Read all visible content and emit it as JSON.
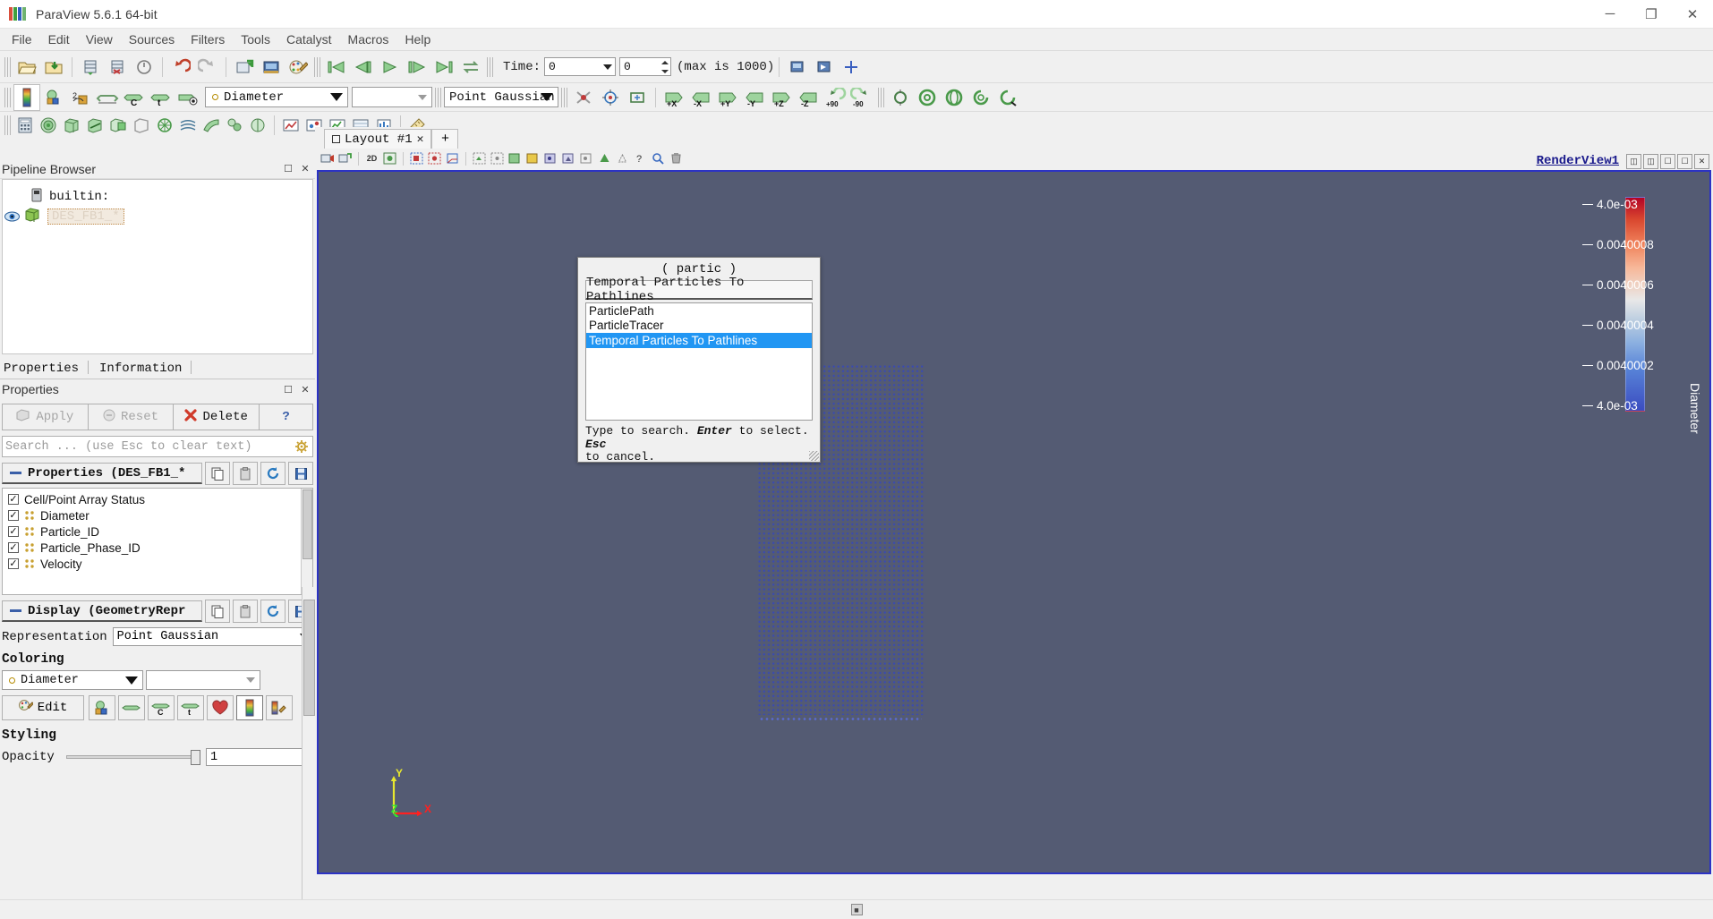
{
  "window": {
    "title": "ParaView 5.6.1 64-bit",
    "controls": {
      "minimize": "─",
      "maximize": "❐",
      "close": "✕"
    }
  },
  "menubar": {
    "items": [
      "File",
      "Edit",
      "View",
      "Sources",
      "Filters",
      "Tools",
      "Catalyst",
      "Macros",
      "Help"
    ]
  },
  "toolbars": {
    "main_icons": [
      "open-file-icon",
      "save-state-icon",
      "connect-server-icon",
      "disconnect-server-icon",
      "timer-icon",
      "undo-icon",
      "redo-icon",
      "camera-undo-icon",
      "save-screenshot-icon",
      "edit-color-map-icon"
    ],
    "vcr_icons": [
      "first-frame-icon",
      "previous-frame-icon",
      "play-icon",
      "next-frame-icon",
      "last-frame-icon",
      "loop-icon"
    ],
    "time": {
      "label": "Time:",
      "value": "0",
      "frame_index": "0",
      "max_text": "(max is 1000)"
    },
    "after_time_icons": [
      "save-data-icon",
      "save-animation-icon",
      "move-center-icon"
    ],
    "row2": {
      "icons_left": [
        "color-legend-icon",
        "rescale-data-range-icon",
        "rescale-custom-icon",
        "rescale-visible-icon",
        "rescale-time-icon",
        "rescale-temporal-icon",
        "rescale-visible-eye-icon"
      ],
      "array_selector": {
        "value": "Diameter",
        "icon": "point-data-icon"
      },
      "component_selector": {
        "value": ""
      },
      "representation": {
        "value": "Point Gaussian"
      },
      "icons_right": [
        "show-center-icon",
        "pick-center-icon",
        "reset-camera-icon",
        "plus-x-icon",
        "minus-x-icon",
        "plus-y-icon",
        "minus-y-icon",
        "plus-z-icon",
        "minus-z-icon",
        "rotate-90-ccw-icon",
        "rotate-90-cw-icon"
      ],
      "axis_labels": [
        "+X",
        "-X",
        "+Y",
        "-Y",
        "+Z",
        "-Z",
        "+90",
        "-90"
      ],
      "icons_far_right": [
        "select-center-icon",
        "sphere-icon",
        "sphere-2-icon",
        "sphere-3-icon",
        "sphere-4-icon"
      ]
    },
    "row3": {
      "icons": [
        "calculator-icon",
        "contour-icon",
        "clip-icon",
        "slice-icon",
        "threshold-icon",
        "extract-subset-icon",
        "glyph-icon",
        "stream-tracer-icon",
        "warp-icon",
        "group-datasets-icon",
        "extract-level-icon",
        "plot-data-icon",
        "plot-over-line-icon",
        "plot-selection-icon",
        "plot-time-icon",
        "plot-attributes-icon",
        "ruler-icon"
      ]
    }
  },
  "pipeline_browser": {
    "title": "Pipeline Browser",
    "dock_icons": [
      "undock-icon",
      "close-icon"
    ],
    "items": [
      {
        "label": "builtin:",
        "icon": "server-icon",
        "eye": false
      },
      {
        "label": "DES_FB1_*",
        "icon": "geometry-icon",
        "eye": true,
        "selected": true
      }
    ]
  },
  "properties_panel": {
    "tabs": [
      "Properties",
      "Information"
    ],
    "title": "Properties",
    "dock_icons": [
      "undock-icon",
      "close-icon"
    ],
    "buttons": [
      {
        "label": "Apply",
        "icon": "apply-icon",
        "enabled": false
      },
      {
        "label": "Reset",
        "icon": "reset-icon",
        "enabled": false
      },
      {
        "label": "Delete",
        "icon": "delete-icon",
        "enabled": true
      },
      {
        "label": "?",
        "icon": "help-icon",
        "enabled": true
      }
    ],
    "search_placeholder": "Search ... (use Esc to clear text)",
    "search_gear_icon": "gear-icon",
    "sections": [
      {
        "name": "properties-section",
        "header": "Properties (DES_FB1_*",
        "header_icons": [
          "copy-icon",
          "paste-icon",
          "restore-defaults-icon",
          "save-defaults-icon"
        ],
        "group_label": "Cell/Point Array Status",
        "group_checked": true,
        "arrays": [
          {
            "label": "Diameter",
            "checked": true
          },
          {
            "label": "Particle_ID",
            "checked": true
          },
          {
            "label": "Particle_Phase_ID",
            "checked": true
          },
          {
            "label": "Velocity",
            "checked": true
          }
        ]
      },
      {
        "name": "display-section",
        "header": "Display (GeometryRepr",
        "header_icons": [
          "copy-icon",
          "paste-icon",
          "restore-defaults-icon",
          "save-defaults-icon"
        ],
        "representation_label": "Representation",
        "representation_value": "Point Gaussian",
        "coloring_label": "Coloring",
        "coloring_value": "Diameter",
        "coloring_component": "",
        "coloring_buttons": [
          {
            "label": "Edit",
            "icon": "edit-color-map-icon"
          },
          {
            "label": "",
            "icon": "rescale-range-icon"
          },
          {
            "label": "",
            "icon": "rescale-custom-icon"
          },
          {
            "label": "",
            "icon": "rescale-over-time-icon"
          },
          {
            "label": "",
            "icon": "rescale-visible-icon"
          },
          {
            "label": "",
            "icon": "choose-preset-icon"
          },
          {
            "label": "",
            "icon": "color-legend-icon"
          },
          {
            "label": "",
            "icon": "edit-color-legend-icon"
          }
        ],
        "styling_label": "Styling",
        "opacity_label": "Opacity",
        "opacity_value": "1"
      }
    ]
  },
  "layout": {
    "tabs": [
      {
        "label": "Layout #1",
        "close": "✕",
        "icon": "layout-icon"
      }
    ],
    "add_tab": "+",
    "view_toolbar_icons": [
      "adjust-camera-icon",
      "camera-undo-icon",
      "2D",
      "interaction-mode-icon",
      "select-cells-icon",
      "select-points-icon",
      "select-frustum-cells-icon",
      "select-surface-cells-icon",
      "select-surface-points-icon",
      "select-block-icon",
      "interactive-select-cells-icon",
      "interactive-select-points-icon",
      "hover-cells-icon",
      "hover-points-icon",
      "zoom-to-box-icon",
      "grow-selection-icon",
      "shrink-selection-icon",
      "query-icon",
      "find-data-icon",
      "clear-selection-icon"
    ],
    "view_toolbar_text": "2D"
  },
  "render_view": {
    "name": "RenderView1",
    "header_buttons": [
      "split-horizontal-icon",
      "split-vertical-icon",
      "maximize-icon",
      "undock-icon",
      "close-icon"
    ],
    "background_color": "#545b73",
    "border_color": "#2c33c4",
    "axes": {
      "x": "X",
      "y": "Y",
      "z": "Z",
      "x_color": "#ff2020",
      "y_color": "#e8e82e",
      "z_color": "#2ee82e"
    },
    "particles": {
      "color": "#2f3f9e",
      "count_label": ""
    }
  },
  "color_legend": {
    "title": "Diameter",
    "ticks": [
      "4.0e-03",
      "0.0040008",
      "0.0040006",
      "0.0040004",
      "0.0040002",
      "4.0e-03"
    ],
    "top_color": "#b30326",
    "mid_color": "#e8e8e8",
    "bottom_color": "#3b4cc0"
  },
  "quick_launch_dialog": {
    "title": "( partic )",
    "search_text": "Temporal Particles To Pathlines",
    "items": [
      {
        "label": "ParticlePath",
        "selected": false
      },
      {
        "label": "ParticleTracer",
        "selected": false
      },
      {
        "label": "Temporal Particles To Pathlines",
        "selected": true
      }
    ],
    "hint_line1_a": "Type to search. ",
    "hint_line1_b": "Enter",
    "hint_line1_c": " to select. ",
    "hint_line1_d": "Esc",
    "hint_line2": "to cancel.",
    "selection_color": "#2196f3"
  },
  "status_bar": {
    "icon": "progress-icon"
  }
}
